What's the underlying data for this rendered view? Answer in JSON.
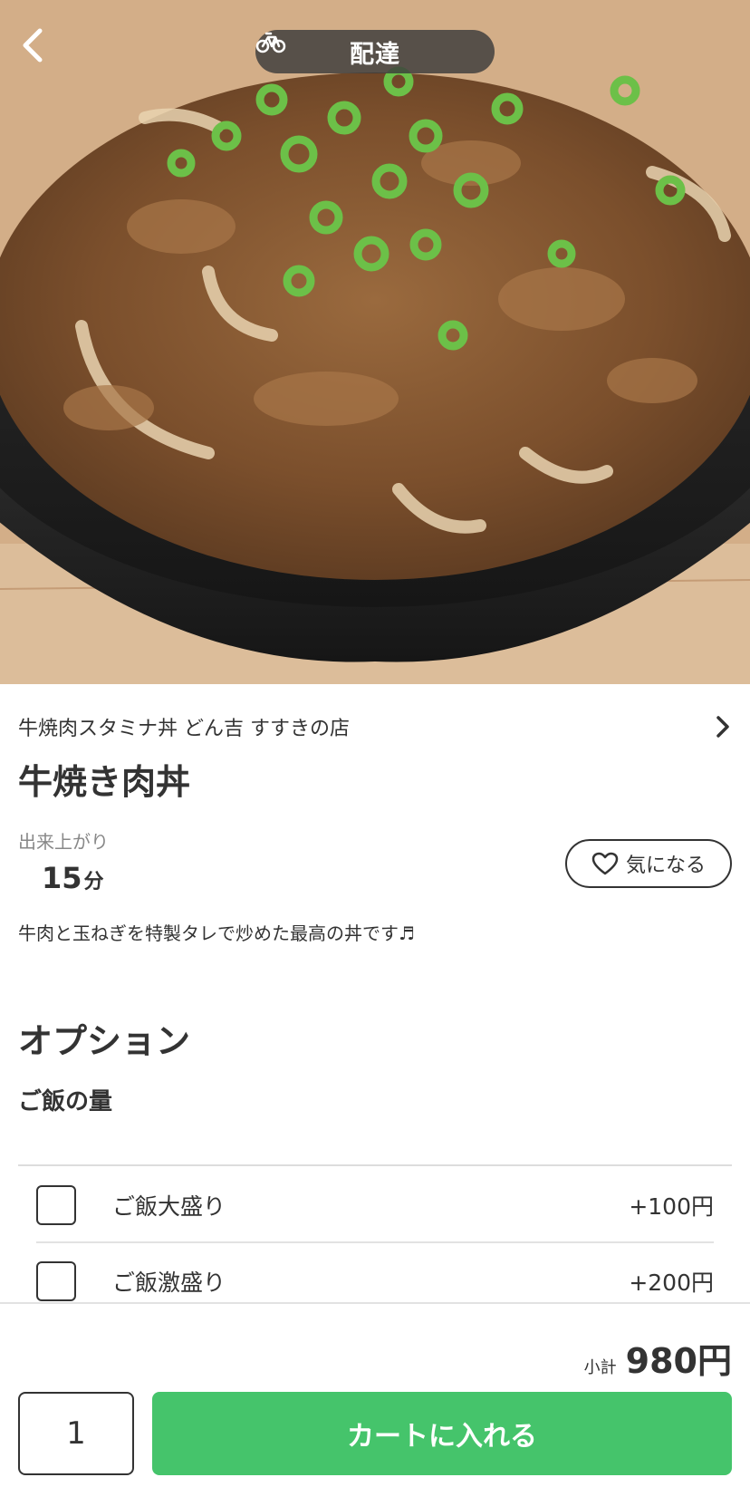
{
  "header": {
    "back_icon": "chevron-left-icon",
    "mode_icon": "bicycle-icon",
    "mode_label": "配達"
  },
  "item": {
    "shop_name": "牛焼肉スタミナ丼 どん吉 すすきの店",
    "title": "牛焼き肉丼",
    "ready_label": "出来上がり",
    "ready_time_value": "15",
    "ready_time_unit": "分",
    "favorite_label": "気になる",
    "description": "牛肉と玉ねぎを特製タレで炒めた最高の丼です♬"
  },
  "options": {
    "title": "オプション",
    "group_title": "ご飯の量",
    "choices": [
      {
        "name": "ご飯大盛り",
        "price": "+100円",
        "checked": false
      },
      {
        "name": "ご飯激盛り",
        "price": "+200円",
        "checked": false
      }
    ]
  },
  "footer": {
    "subtotal_label": "小計",
    "subtotal_amount": "980円",
    "quantity": "1",
    "cart_button_label": "カートに入れる"
  },
  "colors": {
    "accent_green": "#45c46b",
    "text_primary": "#333333",
    "text_muted": "#888888"
  }
}
